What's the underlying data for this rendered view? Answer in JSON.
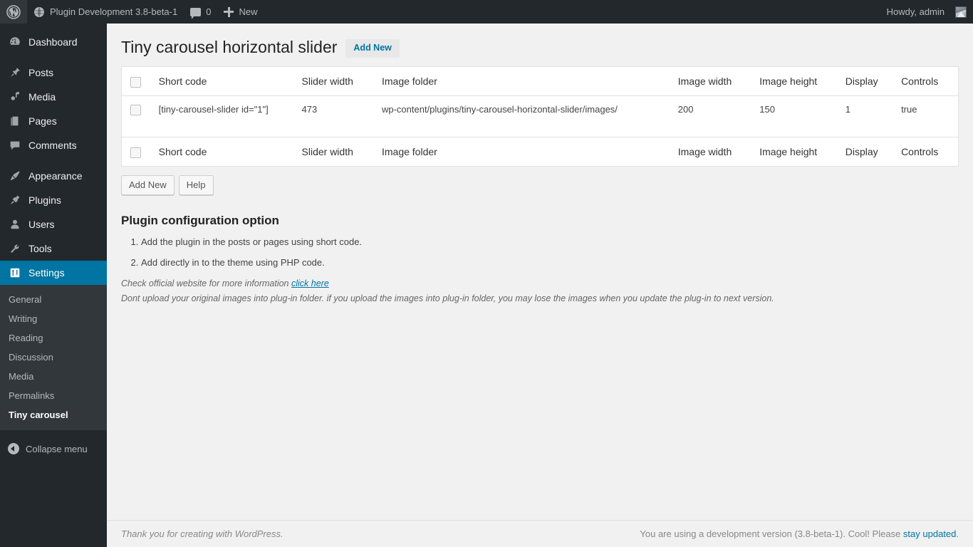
{
  "adminbar": {
    "wp_logo": "wordpress-logo-icon",
    "site_name": "Plugin Development 3.8-beta-1",
    "site_icon": "globe-icon",
    "comments_icon": "comment-bubble-icon",
    "comments_count": "0",
    "new_icon": "plus-icon",
    "new_label": "New",
    "howdy": "Howdy, admin",
    "avatar": "avatar-image"
  },
  "sidebar": {
    "items": [
      {
        "label": "Dashboard",
        "icon": "dashboard-icon",
        "current": false
      },
      {
        "label": "Posts",
        "icon": "pin-icon",
        "current": false
      },
      {
        "label": "Media",
        "icon": "media-icon",
        "current": false
      },
      {
        "label": "Pages",
        "icon": "pages-icon",
        "current": false
      },
      {
        "label": "Comments",
        "icon": "comments-icon",
        "current": false
      },
      {
        "label": "Appearance",
        "icon": "brush-icon",
        "current": false
      },
      {
        "label": "Plugins",
        "icon": "plugins-icon",
        "current": false
      },
      {
        "label": "Users",
        "icon": "users-icon",
        "current": false
      },
      {
        "label": "Tools",
        "icon": "wrench-icon",
        "current": false
      },
      {
        "label": "Settings",
        "icon": "settings-icon",
        "current": true
      }
    ],
    "submenu": [
      {
        "label": "General",
        "current": false
      },
      {
        "label": "Writing",
        "current": false
      },
      {
        "label": "Reading",
        "current": false
      },
      {
        "label": "Discussion",
        "current": false
      },
      {
        "label": "Media",
        "current": false
      },
      {
        "label": "Permalinks",
        "current": false
      },
      {
        "label": "Tiny carousel",
        "current": true
      }
    ],
    "collapse_label": "Collapse menu",
    "collapse_icon": "collapse-arrow-icon"
  },
  "page": {
    "title": "Tiny carousel horizontal slider",
    "add_new_action": "Add New"
  },
  "table": {
    "columns": [
      "Short code",
      "Slider width",
      "Image folder",
      "Image width",
      "Image height",
      "Display",
      "Controls"
    ],
    "select_all_checkbox": "select-all",
    "rows": [
      {
        "checkbox": "row-checkbox",
        "short_code": "[tiny-carousel-slider id=\"1\"]",
        "slider_width": "473",
        "image_folder": "wp-content/plugins/tiny-carousel-horizontal-slider/images/",
        "image_width": "200",
        "image_height": "150",
        "display": "1",
        "controls": "true"
      }
    ]
  },
  "buttons": {
    "add_new": "Add New",
    "help": "Help"
  },
  "config": {
    "heading": "Plugin configuration option",
    "items": [
      "Add the plugin in the posts or pages using short code.",
      "Add directly in to the theme using PHP code."
    ]
  },
  "notes": {
    "line1_pre": "Check official website for more information ",
    "line1_link": "click here",
    "line2": "Dont upload your original images into plug-in folder. if you upload the images into plug-in folder, you may lose the images when you update the plug-in to next version."
  },
  "footer": {
    "left_pre": "Thank you for creating with ",
    "left_link": "WordPress",
    "left_post": ".",
    "right_pre": "You are using a development version (3.8-beta-1). Cool! Please ",
    "right_link": "stay updated",
    "right_post": "."
  },
  "colors": {
    "admin_bg": "#23282d",
    "submenu_bg": "#32373c",
    "accent_blue": "#0074a2",
    "content_bg": "#f1f1f1",
    "link_blue": "#0074a2"
  }
}
